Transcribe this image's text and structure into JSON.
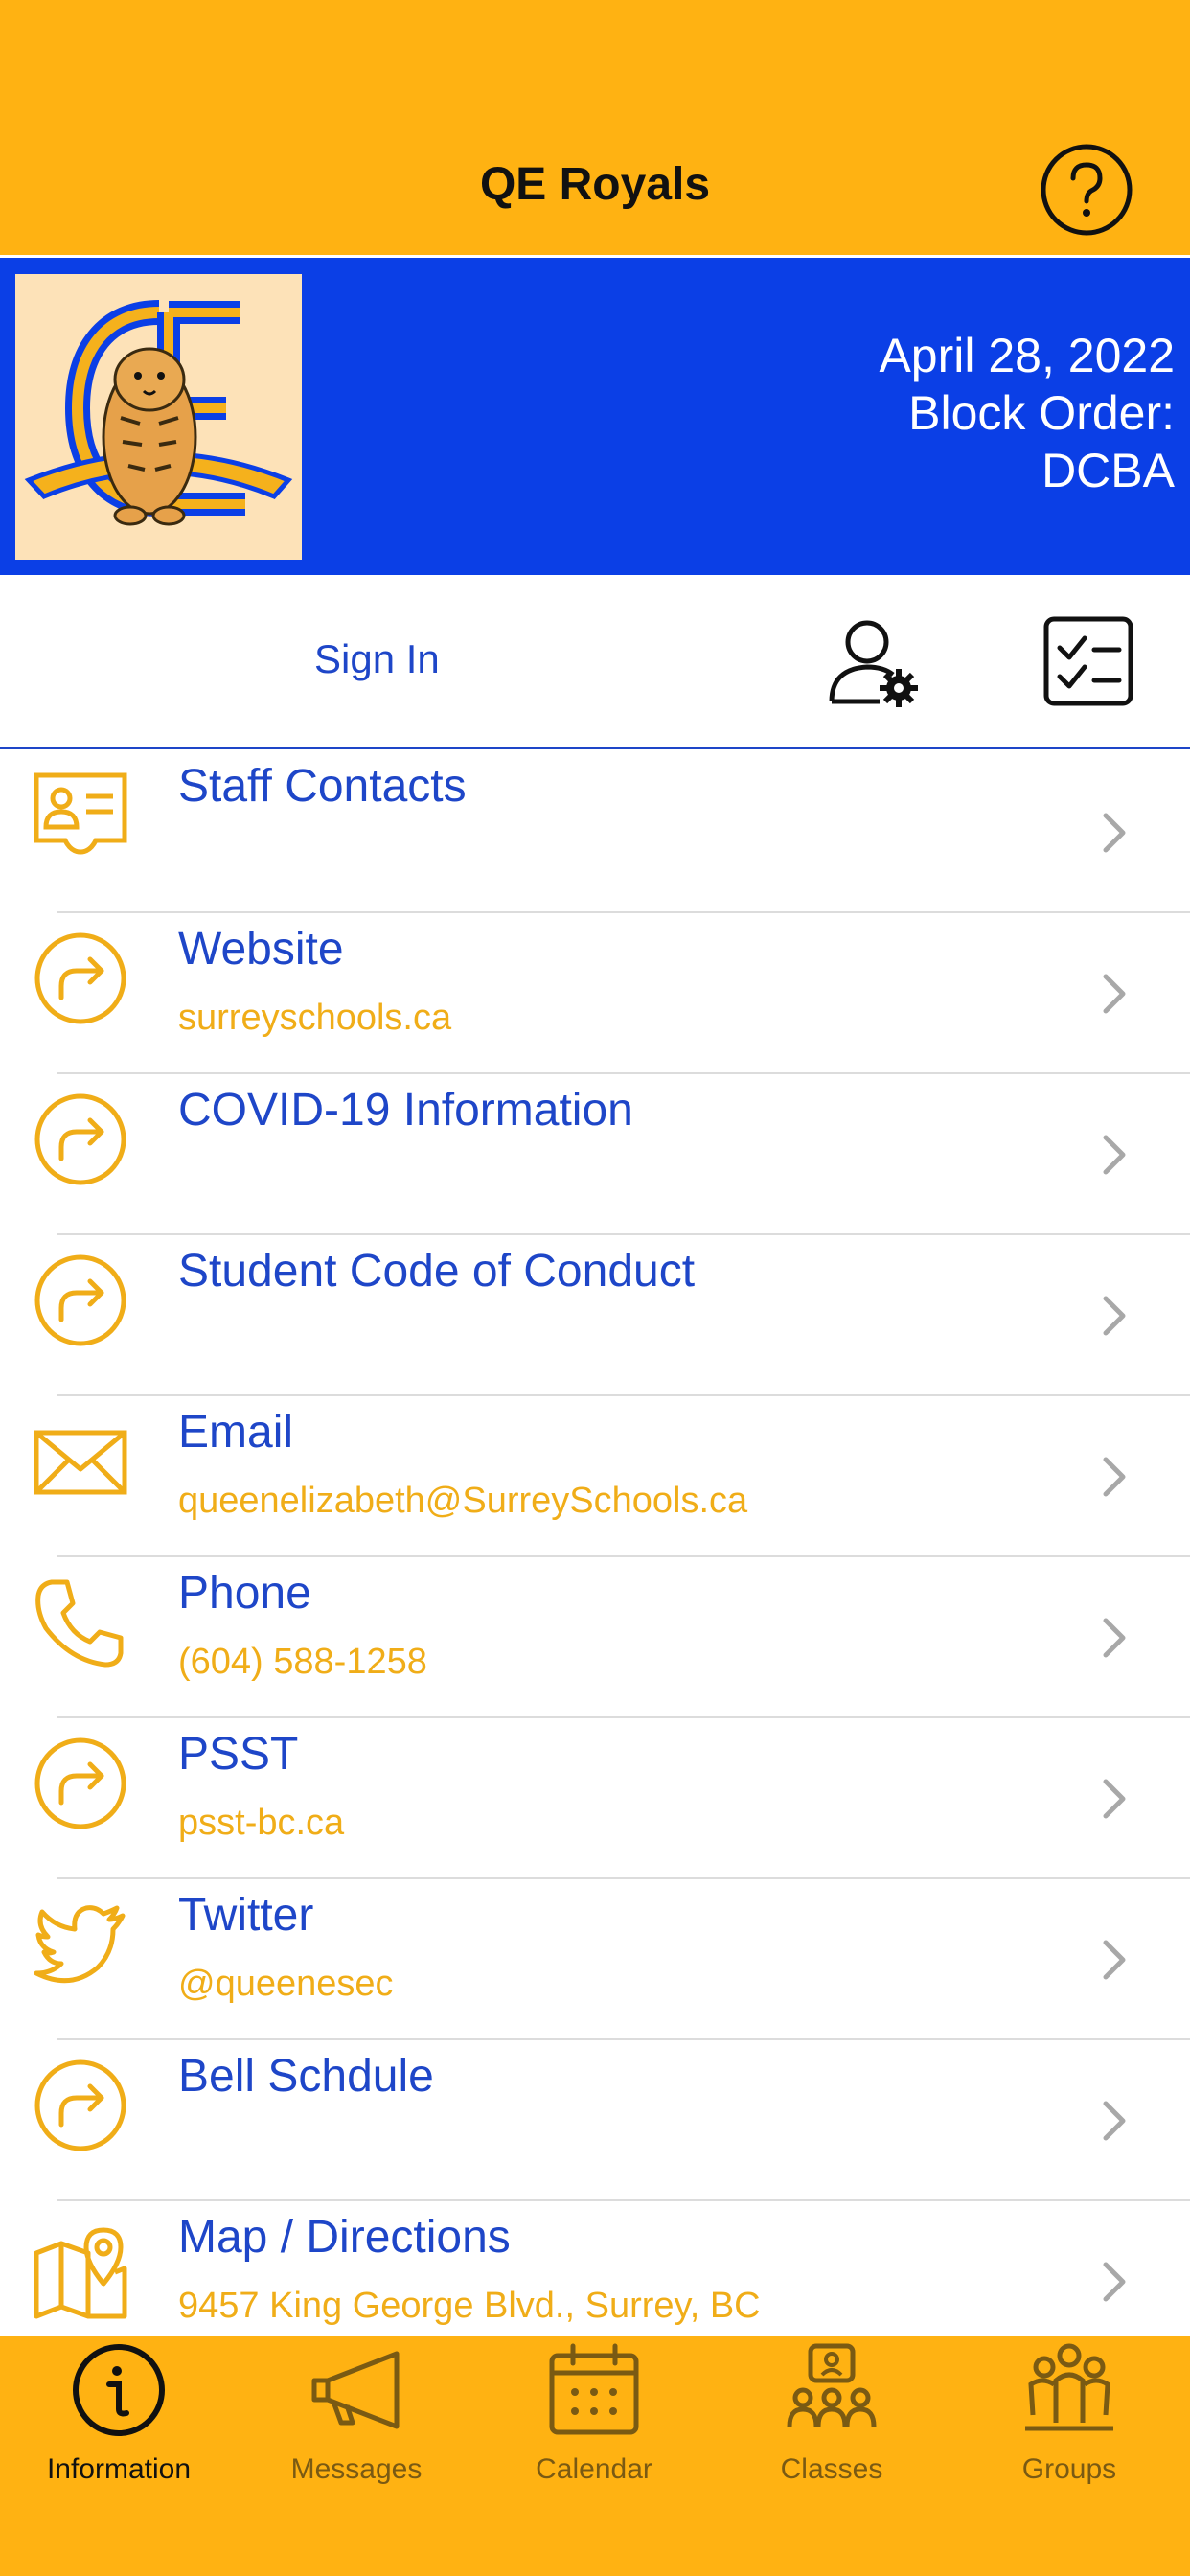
{
  "header": {
    "title": "QE Royals",
    "help_icon": "help-circle-icon"
  },
  "banner": {
    "date": "April 28, 2022",
    "block_label": "Block Order:",
    "block_value": "DCBA",
    "logo_icon": "tiger-logo"
  },
  "account": {
    "sign_in_label": "Sign In",
    "user_settings_icon": "user-settings-icon",
    "checklist_icon": "checklist-icon"
  },
  "list": {
    "items": [
      {
        "title": "Staff Contacts",
        "subtitle": "",
        "icon": "contact-card-icon"
      },
      {
        "title": "Website",
        "subtitle": "surreyschools.ca",
        "icon": "redirect-icon"
      },
      {
        "title": "COVID-19 Information",
        "subtitle": "",
        "icon": "redirect-icon"
      },
      {
        "title": "Student Code of Conduct",
        "subtitle": "",
        "icon": "redirect-icon"
      },
      {
        "title": "Email",
        "subtitle": "queenelizabeth@SurreySchools.ca",
        "icon": "envelope-icon"
      },
      {
        "title": "Phone",
        "subtitle": "(604) 588-1258",
        "icon": "phone-icon"
      },
      {
        "title": "PSST",
        "subtitle": "psst-bc.ca",
        "icon": "redirect-icon"
      },
      {
        "title": "Twitter",
        "subtitle": "@queenesec",
        "icon": "twitter-bird-icon"
      },
      {
        "title": "Bell Schdule",
        "subtitle": "",
        "icon": "redirect-icon"
      },
      {
        "title": "Map / Directions",
        "subtitle": "9457 King George Blvd., Surrey, BC",
        "icon": "map-pin-icon"
      }
    ]
  },
  "tabs": [
    {
      "label": "Information",
      "icon": "info-icon",
      "active": true
    },
    {
      "label": "Messages",
      "icon": "megaphone-icon",
      "active": false
    },
    {
      "label": "Calendar",
      "icon": "calendar-icon",
      "active": false
    },
    {
      "label": "Classes",
      "icon": "classes-icon",
      "active": false
    },
    {
      "label": "Groups",
      "icon": "groups-icon",
      "active": false
    }
  ],
  "colors": {
    "primary_gold": "#FFB212",
    "banner_blue": "#0B3FE6",
    "link_blue": "#1E46C8",
    "subtitle_gold": "#F0AD18"
  }
}
